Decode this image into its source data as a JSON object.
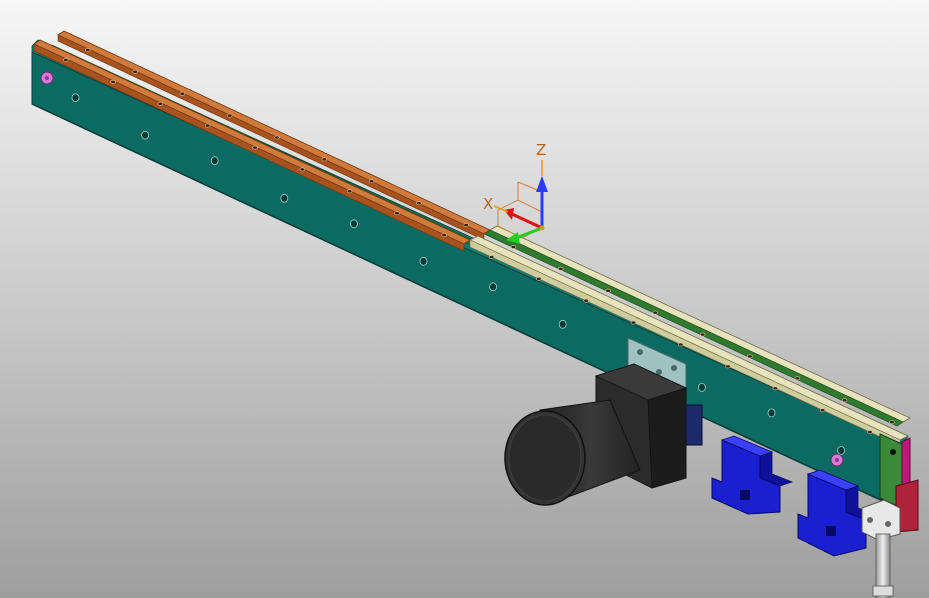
{
  "viewport": {
    "background_top": "#f7f7f7",
    "background_bottom": "#9e9e9e"
  },
  "colors": {
    "beam_front": "#0b6b63",
    "beam_top": "#0f7c72",
    "beam_end": "#0a5a55",
    "rail_wood": "#b8612a",
    "rail_wood_light": "#d07a3c",
    "rail_cream": "#e6e3bd",
    "rail_green": "#2f7a2f",
    "motor_black": "#2b2b2b",
    "mount_plate": "#9fc2c2",
    "support_blue": "#1a1fd0",
    "end_magenta": "#c0187a",
    "end_red": "#b0223a",
    "end_white": "#e8e8e8"
  },
  "triad": {
    "z_label": "Z",
    "x_label": "X",
    "z_color": "#2a3dff",
    "x_color": "#e01010",
    "y_color": "#20d020"
  },
  "parts": {
    "beam": "beam",
    "rails": "guide-rails",
    "motor": "servo-motor",
    "supports": "support-brackets",
    "end_block": "end-block",
    "rod": "piston-rod"
  }
}
